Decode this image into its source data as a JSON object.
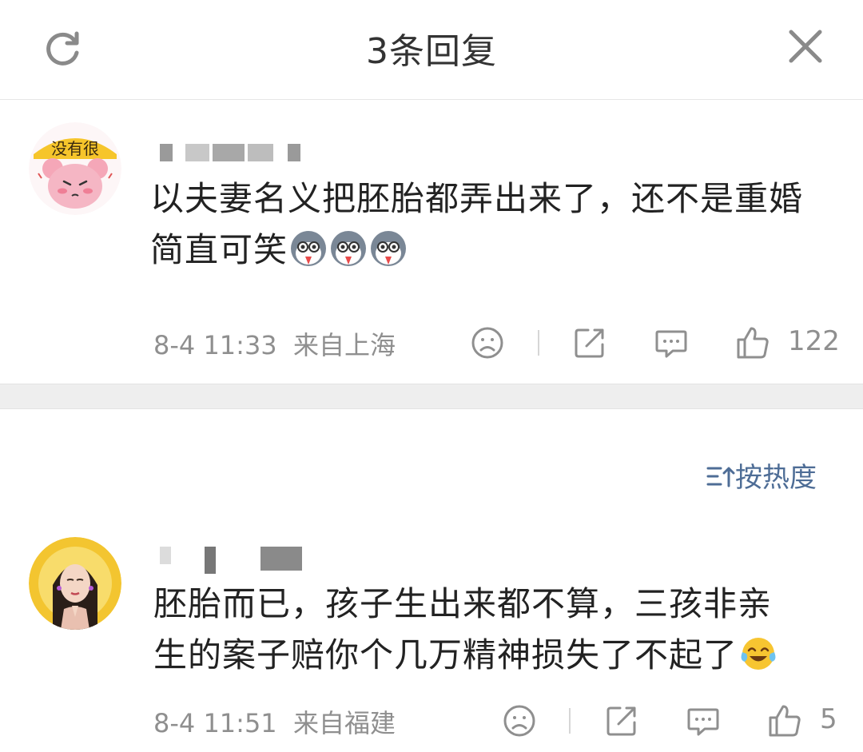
{
  "header": {
    "title": "3条回复",
    "refresh_icon": "refresh-icon",
    "close_icon": "close-icon"
  },
  "main_comment": {
    "avatar_caption": "没有很",
    "text_line1": "以夫妻名义把胚胎都弄出来了，还不是重婚",
    "text_line2": "简直可笑",
    "emojis": [
      "husky-emoji",
      "husky-emoji",
      "husky-emoji"
    ],
    "time": "8-4 11:33",
    "location": "来自上海",
    "like_count": "122"
  },
  "sort": {
    "label": "按热度"
  },
  "reply": {
    "text_line1": "胚胎而已，孩子生出来都不算，三孩非亲",
    "text_line2": "生的案子赔你个几万精神损失了不起了",
    "emoji": "tears-of-joy-emoji",
    "time": "8-4 11:51",
    "location": "来自福建",
    "like_count_partial": "5"
  },
  "colors": {
    "accent_link": "#4e6d96",
    "meta_gray": "#8f8f8f",
    "text_dark": "#222222",
    "gap_gray": "#eeeeee"
  }
}
